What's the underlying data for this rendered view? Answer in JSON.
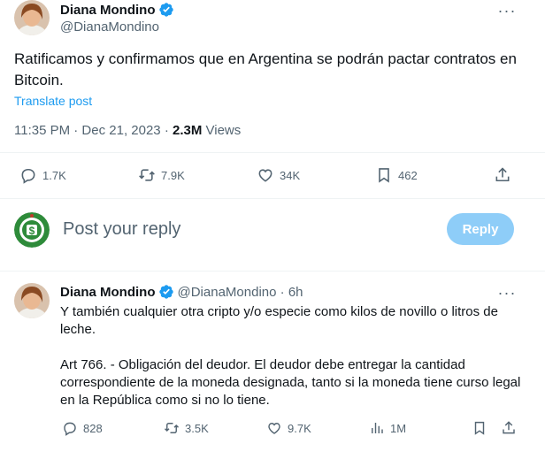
{
  "main_post": {
    "author_name": "Diana Mondino",
    "author_handle": "@DianaMondino",
    "text": "Ratificamos y confirmamos que en Argentina se podrán pactar contratos en Bitcoin.",
    "translate_label": "Translate post",
    "timestamp": "11:35 PM · Dec 21, 2023 · ",
    "views_count": "2.3M",
    "views_label": " Views",
    "stats": {
      "replies": "1.7K",
      "reposts": "7.9K",
      "likes": "34K",
      "bookmarks": "462"
    }
  },
  "composer": {
    "placeholder": "Post your reply",
    "reply_button": "Reply"
  },
  "reply_post": {
    "author_name": "Diana Mondino",
    "author_handle": "@DianaMondino",
    "separator": " · ",
    "time_ago": "6h",
    "paragraph1": "Y también cualquier otra cripto y/o especie como kilos de novillo o litros de leche.",
    "paragraph2": "Art 766. - Obligación del deudor. El deudor debe entregar la cantidad correspondiente de la moneda designada, tanto si la moneda tiene curso legal en la República como si no lo tiene.",
    "stats": {
      "replies": "828",
      "reposts": "3.5K",
      "likes": "9.7K",
      "views": "1M"
    }
  },
  "colors": {
    "accent": "#1d9bf0",
    "verified": "#1d9bf0",
    "reply_button_disabled": "#8ecdf8",
    "secondary_text": "#536471",
    "composer_avatar_bg": "#2e8b3a"
  },
  "icons": [
    "verified-badge-icon",
    "more-icon",
    "reply-icon",
    "repost-icon",
    "like-icon",
    "bookmark-icon",
    "share-icon",
    "views-icon"
  ]
}
